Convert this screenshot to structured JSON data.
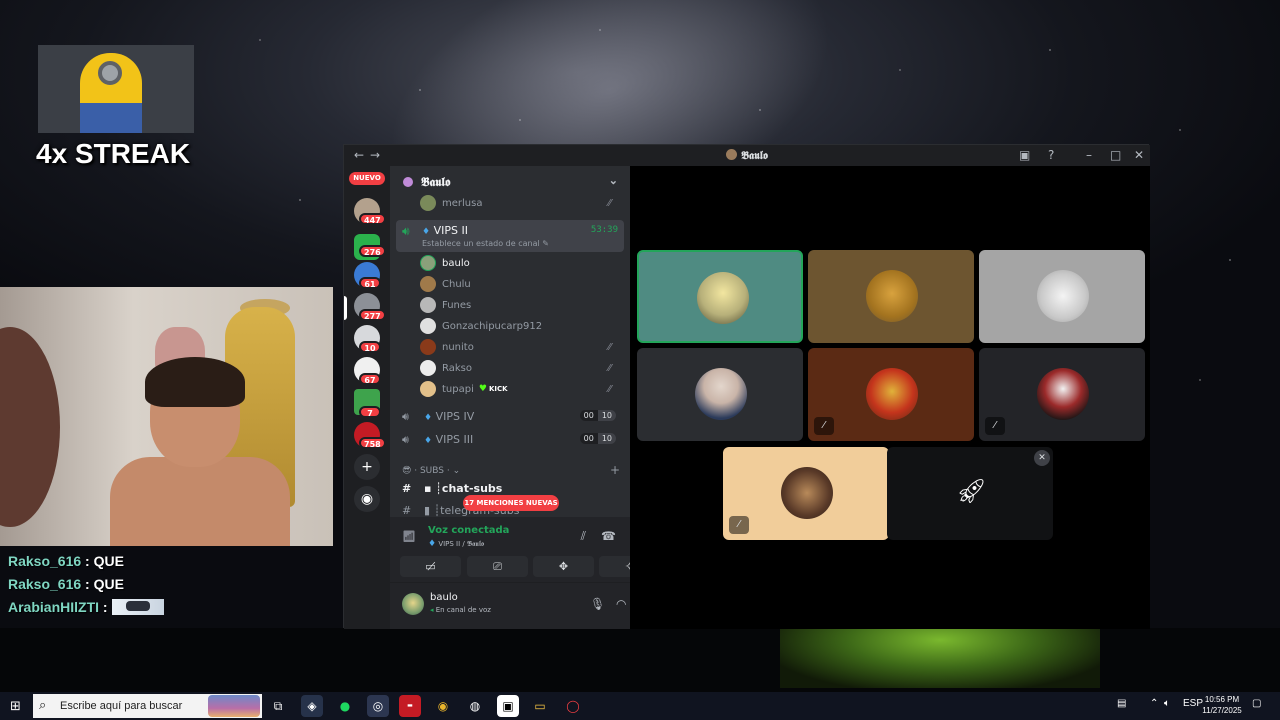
{
  "overlay": {
    "streak_text": "4x STREAK",
    "chat": [
      {
        "user": "Rakso_616",
        "message": "QUE"
      },
      {
        "user": "Rakso_616",
        "message": "QUE"
      },
      {
        "user": "ArabianHIlZTI",
        "message": ""
      }
    ]
  },
  "discord": {
    "window_title": "𝕭𝖆𝖚𝖑𝖔",
    "server_name": "𝕭𝖆𝖚𝖑𝖔",
    "nuevo_label": "NUEVO",
    "server_badges": [
      "447",
      "276",
      "61",
      "277",
      "10",
      "67",
      "7",
      "758"
    ],
    "top_user": "merlusa",
    "active_channel": {
      "name": "VIPS II",
      "timer": "53:39",
      "status": "Establece un estado de canal ✎"
    },
    "voice_members": [
      {
        "name": "baulo",
        "active": true,
        "muted": false,
        "badge": ""
      },
      {
        "name": "Chulu",
        "active": false,
        "muted": false,
        "badge": ""
      },
      {
        "name": "Funes",
        "active": false,
        "muted": false,
        "badge": ""
      },
      {
        "name": "Gonzachipucarp912",
        "active": false,
        "muted": false,
        "badge": ""
      },
      {
        "name": "nunito",
        "active": false,
        "muted": true,
        "badge": ""
      },
      {
        "name": "Rakso",
        "active": false,
        "muted": true,
        "badge": ""
      },
      {
        "name": "tupapi",
        "active": false,
        "muted": true,
        "badge": "KICK"
      }
    ],
    "other_channels": [
      {
        "name": "VIPS IV",
        "count_a": "00",
        "count_b": "10"
      },
      {
        "name": "VIPS III",
        "count_a": "00",
        "count_b": "10"
      }
    ],
    "category": "· SUBS ·",
    "text_channels": [
      "┊chat-subs",
      "┊telegram-subs"
    ],
    "mentions_badge": "17 MENCIONES NUEVAS",
    "voice_status": "Voz conectada",
    "voice_location": "VIPS II / 𝕭𝖆𝖚𝖑𝖔",
    "user": {
      "name": "baulo",
      "status": "En canal de voz"
    }
  },
  "taskbar": {
    "search_placeholder": "Escribe aquí para buscar",
    "lang": "ESP",
    "time": "10:56 PM",
    "date": "11/27/2025"
  }
}
